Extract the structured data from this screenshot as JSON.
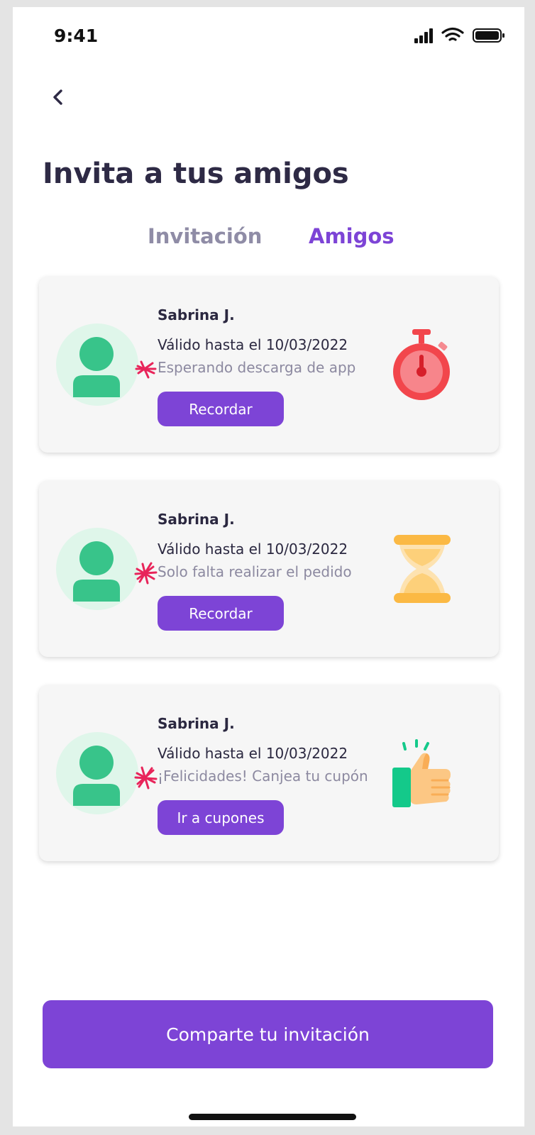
{
  "status_bar": {
    "time": "9:41"
  },
  "header": {
    "title": "Invita a tus amigos"
  },
  "tabs": [
    {
      "label": "Invitación",
      "active": false
    },
    {
      "label": "Amigos",
      "active": true
    }
  ],
  "friends": [
    {
      "name": "Sabrina J.",
      "valid": "Válido hasta el 10/03/2022",
      "status": "Esperando descarga de app",
      "button": "Recordar",
      "icon": "stopwatch-icon"
    },
    {
      "name": "Sabrina J.",
      "valid": "Válido hasta el 10/03/2022",
      "status": "Solo falta realizar el pedido",
      "button": "Recordar",
      "icon": "hourglass-icon"
    },
    {
      "name": "Sabrina J.",
      "valid": "Válido hasta el 10/03/2022",
      "status": "¡Felicidades! Canjea tu cupón",
      "button": "Ir a cupones",
      "icon": "thumbs-up-icon"
    }
  ],
  "footer": {
    "share_label": "Comparte tu invitación"
  },
  "colors": {
    "accent": "#7d44d6",
    "title": "#2e2a45",
    "avatar_bg": "#dff6ea",
    "avatar": "#38c48a"
  }
}
